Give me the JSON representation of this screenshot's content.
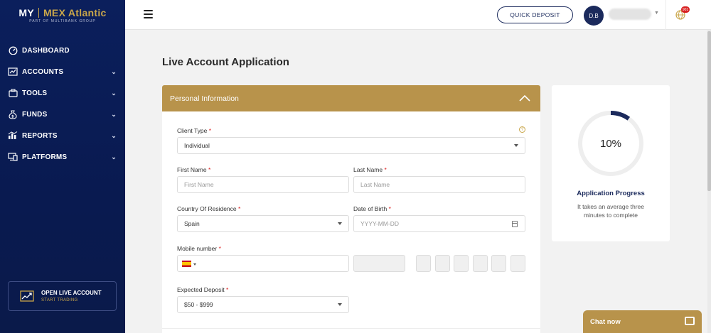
{
  "brand": {
    "my": "MY",
    "name": "MEX Atlantic",
    "tagline": "PART OF MULTIBANK GROUP"
  },
  "sidebar": {
    "items": [
      {
        "label": "DASHBOARD",
        "icon": "dashboard-icon",
        "has_chevron": false
      },
      {
        "label": "ACCOUNTS",
        "icon": "accounts-icon",
        "has_chevron": true
      },
      {
        "label": "TOOLS",
        "icon": "tools-icon",
        "has_chevron": true
      },
      {
        "label": "FUNDS",
        "icon": "funds-icon",
        "has_chevron": true
      },
      {
        "label": "REPORTS",
        "icon": "reports-icon",
        "has_chevron": true
      },
      {
        "label": "PLATFORMS",
        "icon": "platforms-icon",
        "has_chevron": true
      }
    ],
    "open_live": {
      "title": "OPEN LIVE ACCOUNT",
      "subtitle": "START TRADING"
    }
  },
  "topbar": {
    "quick_deposit": "QUICK DEPOSIT",
    "avatar_initials": "D.B",
    "notification_badge": "901"
  },
  "page": {
    "title": "Live Account Application"
  },
  "form": {
    "section_title": "Personal Information",
    "client_type": {
      "label": "Client Type",
      "value": "Individual"
    },
    "first_name": {
      "label": "First Name",
      "placeholder": "First Name"
    },
    "last_name": {
      "label": "Last Name",
      "placeholder": "Last Name"
    },
    "country": {
      "label": "Country Of Residence",
      "value": "Spain"
    },
    "dob": {
      "label": "Date of Birth",
      "placeholder": "YYYY-MM-DD"
    },
    "mobile": {
      "label": "Mobile number"
    },
    "expected_deposit": {
      "label": "Expected Deposit",
      "value": "$50 - $999"
    },
    "required_mark": "*",
    "help_glyph": "?"
  },
  "progress": {
    "percent_text": "10%",
    "percent_value": 10,
    "title": "Application Progress",
    "description": "It takes an average three minutes to complete"
  },
  "chat": {
    "label": "Chat now"
  },
  "colors": {
    "navy": "#1b2a5c",
    "gold": "#b8934b",
    "sidebar": "#0b1f5c"
  }
}
